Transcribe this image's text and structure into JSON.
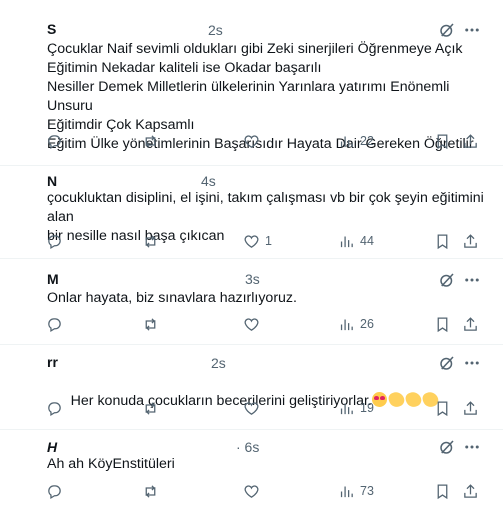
{
  "colors": {
    "muted": "#536471",
    "text": "#0f1419",
    "divider": "#eff3f4"
  },
  "icons": [
    "grok-icon",
    "more-icon",
    "reply-icon",
    "retweet-icon",
    "like-icon",
    "views-icon",
    "bookmark-icon",
    "share-icon"
  ],
  "posts": [
    {
      "author": "S",
      "time": "2s",
      "text": "Çocuklar Naif sevimli oldukları gibi Zeki sinerjileri Öğrenmeye Açık\nEğitimin Nekadar kaliteli ise Okadar başarılı\nNesiller Demek Milletlerin ülkelerinin Yarınlara yatırımı Enönemli Unsuru\nEğitimdir Çok Kapsamlı\nEğitim Ülke yönetimlerinin Başarısıdır Hayata Dair Gereken Öğretilir",
      "likes": "",
      "views": "22"
    },
    {
      "author": "N",
      "time": "4s",
      "text": "çocukluktan disiplini, el işini, takım çalışması vb bir çok şeyin eğitimini alan\nbir nesille nasıl başa çıkıcan",
      "likes": "1",
      "views": "44"
    },
    {
      "author": "M",
      "time": "3s",
      "text": "Onlar hayata, biz sınavlara hazırlıyoruz.",
      "likes": "",
      "views": "26"
    },
    {
      "author": "rr",
      "time": "2s",
      "text": "Her konuda çocukların becerilerini geliştiriyorlar.",
      "emoji": [
        "smiling-face-with-heart-eyes",
        "clapping-hands",
        "clapping-hands",
        "clapping-hands"
      ],
      "likes": "",
      "views": "19"
    },
    {
      "author": "H",
      "time": "· 6s",
      "text": "Ah ah KöyEnstitüleri",
      "likes": "",
      "views": "73"
    }
  ]
}
